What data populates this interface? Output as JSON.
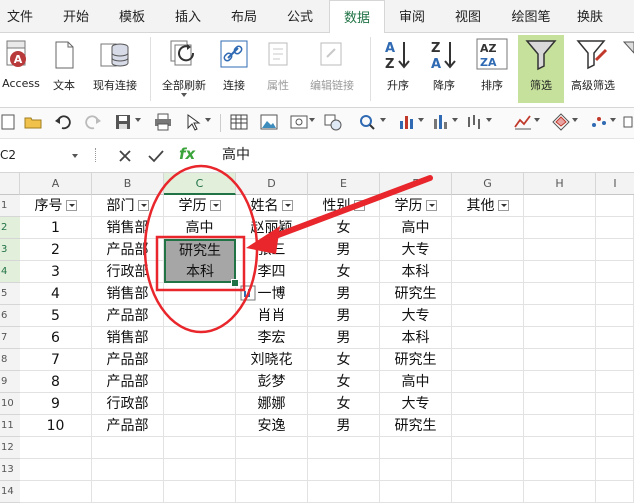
{
  "ribbon_tabs": [
    "文件",
    "开始",
    "模板",
    "插入",
    "布局",
    "公式",
    "数据",
    "审阅",
    "视图",
    "绘图笔",
    "换肤"
  ],
  "active_tab": "数据",
  "ribbon_buttons": {
    "access": "Access",
    "text": "文本",
    "existing": "现有连接",
    "refresh_all": "全部刷新",
    "connections": "连接",
    "properties": "属性",
    "edit_links": "编辑链接",
    "sort_asc": "升序",
    "sort_desc": "降序",
    "sort": "排序",
    "filter": "筛选",
    "advanced_filter": "高级筛选"
  },
  "formula_bar": {
    "name_box": "C2",
    "fx": "fx",
    "content": "高中"
  },
  "columns": [
    "A",
    "B",
    "C",
    "D",
    "E",
    "F",
    "G",
    "H",
    "I"
  ],
  "rows": [
    "1",
    "2",
    "3",
    "4",
    "5",
    "6",
    "7",
    "8",
    "9",
    "10",
    "11",
    "12",
    "13",
    "14"
  ],
  "headers": {
    "A": "序号",
    "B": "部门",
    "C": "学历",
    "D": "姓名",
    "E": "性别",
    "F": "学历",
    "G": "其他"
  },
  "table": [
    {
      "A": "1",
      "B": "销售部",
      "C": "高中",
      "D": "赵丽颖",
      "E": "女",
      "F": "高中"
    },
    {
      "A": "2",
      "B": "产品部",
      "C": "研究生",
      "D": "张三",
      "E": "男",
      "F": "大专"
    },
    {
      "A": "3",
      "B": "行政部",
      "C": "本科",
      "D": "李四",
      "E": "女",
      "F": "本科"
    },
    {
      "A": "4",
      "B": "销售部",
      "C": "",
      "D": "一博",
      "E": "男",
      "F": "研究生"
    },
    {
      "A": "5",
      "B": "产品部",
      "C": "",
      "D": "肖肖",
      "E": "男",
      "F": "大专"
    },
    {
      "A": "6",
      "B": "销售部",
      "C": "",
      "D": "李宏",
      "E": "男",
      "F": "本科"
    },
    {
      "A": "7",
      "B": "产品部",
      "C": "",
      "D": "刘晓花",
      "E": "女",
      "F": "研究生"
    },
    {
      "A": "8",
      "B": "产品部",
      "C": "",
      "D": "彭梦",
      "E": "女",
      "F": "高中"
    },
    {
      "A": "9",
      "B": "行政部",
      "C": "",
      "D": "娜娜",
      "E": "女",
      "F": "大专"
    },
    {
      "A": "10",
      "B": "产品部",
      "C": "",
      "D": "安逸",
      "E": "男",
      "F": "研究生"
    }
  ],
  "colors": {
    "accent": "#217346",
    "annotation_red": "#e8262b",
    "selection_fill": "#a6a6a6",
    "filter_highlight": "#c6e19c"
  }
}
